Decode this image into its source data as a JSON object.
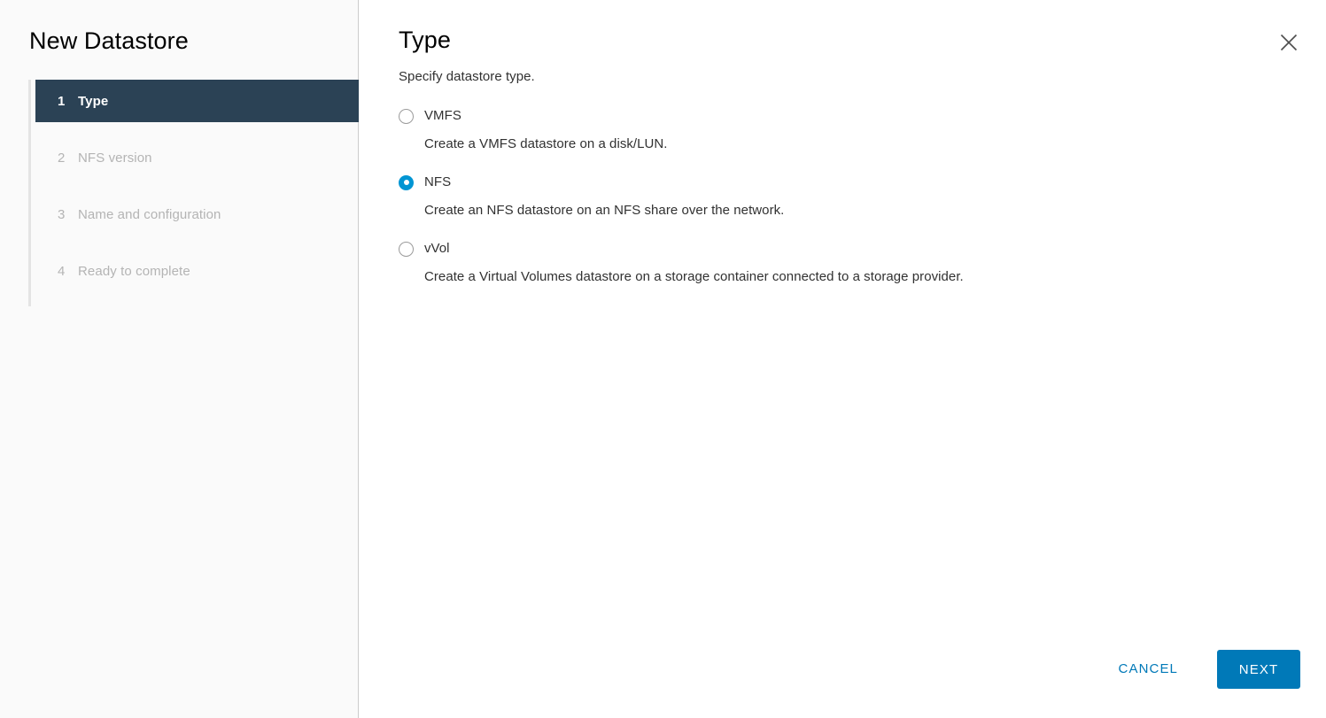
{
  "window": {
    "title": "New Datastore",
    "close_icon": "close-icon"
  },
  "sidebar": {
    "title": "New Datastore",
    "steps": [
      {
        "num": "1",
        "label": "Type",
        "active": true
      },
      {
        "num": "2",
        "label": "NFS version",
        "active": false
      },
      {
        "num": "3",
        "label": "Name and configuration",
        "active": false
      },
      {
        "num": "4",
        "label": "Ready to complete",
        "active": false
      }
    ]
  },
  "main": {
    "title": "Type",
    "subtitle": "Specify datastore type.",
    "options": [
      {
        "id": "vmfs",
        "label": "VMFS",
        "description": "Create a VMFS datastore on a disk/LUN.",
        "selected": false
      },
      {
        "id": "nfs",
        "label": "NFS",
        "description": "Create an NFS datastore on an NFS share over the network.",
        "selected": true
      },
      {
        "id": "vvol",
        "label": "vVol",
        "description": "Create a Virtual Volumes datastore on a storage container connected to a storage provider.",
        "selected": false
      }
    ]
  },
  "footer": {
    "cancel_label": "CANCEL",
    "next_label": "NEXT"
  },
  "colors": {
    "accent_blue": "#0079b8",
    "radio_blue": "#0095d3",
    "active_step_bg": "#2b4255",
    "sidebar_bg": "#fafafa",
    "text": "#313131",
    "muted_text": "#b4b4b4"
  }
}
